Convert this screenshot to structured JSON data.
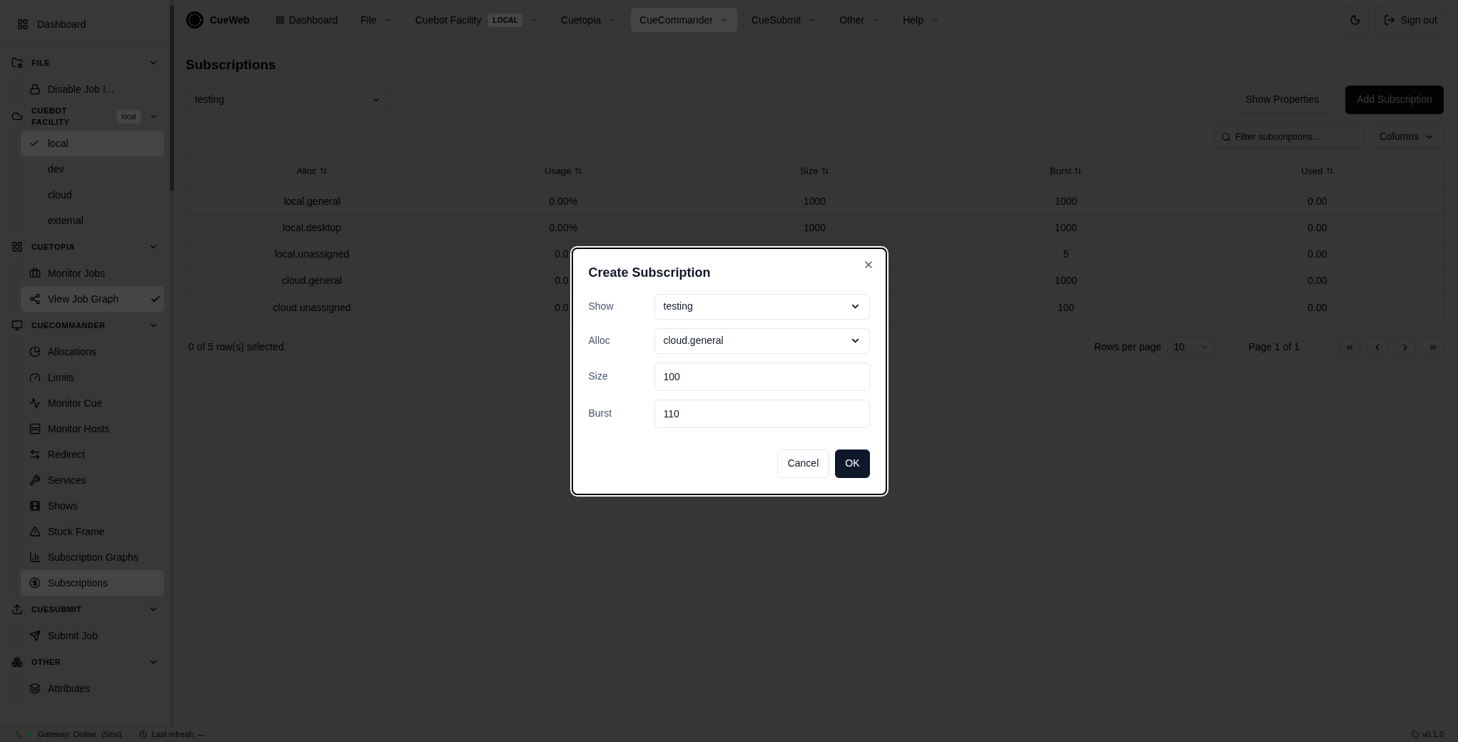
{
  "sidebar": {
    "top_item": {
      "label": "Dashboard"
    },
    "sections": [
      {
        "title": "FILE",
        "expanded": true,
        "items": [
          {
            "label": "Disable Job I...",
            "kind": "link",
            "selected": false,
            "checked": false
          }
        ]
      },
      {
        "title": "CUEBOT FACILITY",
        "badge": "local",
        "expanded": true,
        "items": [
          {
            "label": "local",
            "kind": "option",
            "selected": true,
            "checked": true
          },
          {
            "label": "dev",
            "kind": "option",
            "selected": false,
            "checked": false
          },
          {
            "label": "cloud",
            "kind": "option",
            "selected": false,
            "checked": false
          },
          {
            "label": "external",
            "kind": "option",
            "selected": false,
            "checked": false
          }
        ]
      },
      {
        "title": "CUETOPIA",
        "expanded": true,
        "items": [
          {
            "label": "Monitor Jobs",
            "kind": "link",
            "selected": false,
            "checked": false
          },
          {
            "label": "View Job Graph",
            "kind": "link",
            "selected": true,
            "checked": true
          }
        ]
      },
      {
        "title": "CUECOMMANDER",
        "expanded": true,
        "items": [
          {
            "label": "Allocations",
            "kind": "link",
            "selected": false,
            "checked": false
          },
          {
            "label": "Limits",
            "kind": "link",
            "selected": false,
            "checked": false
          },
          {
            "label": "Monitor Cue",
            "kind": "link",
            "selected": false,
            "checked": false
          },
          {
            "label": "Monitor Hosts",
            "kind": "link",
            "selected": false,
            "checked": false
          },
          {
            "label": "Redirect",
            "kind": "link",
            "selected": false,
            "checked": false
          },
          {
            "label": "Services",
            "kind": "link",
            "selected": false,
            "checked": false
          },
          {
            "label": "Shows",
            "kind": "link",
            "selected": false,
            "checked": false
          },
          {
            "label": "Stuck Frame",
            "kind": "link",
            "selected": false,
            "checked": false
          },
          {
            "label": "Subscription Graphs",
            "kind": "link",
            "selected": false,
            "checked": false
          },
          {
            "label": "Subscriptions",
            "kind": "link",
            "selected": true,
            "checked": false
          }
        ]
      },
      {
        "title": "CUESUBMIT",
        "expanded": true,
        "items": [
          {
            "label": "Submit Job",
            "kind": "link",
            "selected": false,
            "checked": false
          }
        ]
      },
      {
        "title": "OTHER",
        "expanded": true,
        "items": [
          {
            "label": "Attributes",
            "kind": "link",
            "selected": false,
            "checked": false
          }
        ]
      }
    ]
  },
  "header": {
    "brand": "CueWeb",
    "nav": [
      {
        "label": "Dashboard",
        "kind": "link",
        "selected": false
      },
      {
        "label": "File",
        "kind": "menu",
        "selected": false
      },
      {
        "label": "Cuebot Facility",
        "kind": "menu",
        "badge": "LOCAL",
        "selected": false
      },
      {
        "label": "Cuetopia",
        "kind": "menu",
        "selected": false
      },
      {
        "label": "CueCommander",
        "kind": "menu",
        "selected": true
      },
      {
        "label": "CueSubmit",
        "kind": "menu",
        "selected": false
      },
      {
        "label": "Other",
        "kind": "menu",
        "selected": false
      },
      {
        "label": "Help",
        "kind": "menu",
        "selected": false
      }
    ],
    "sign_out": "Sign out"
  },
  "page": {
    "title": "Subscriptions",
    "show_select": "testing",
    "buttons": [
      {
        "label": "Show Properties",
        "kind": "secondary"
      },
      {
        "label": "Add Subscription",
        "kind": "primary"
      }
    ],
    "filter": {
      "placeholder": "Filter subscriptions..."
    },
    "columns_button": "Columns"
  },
  "table": {
    "columns": [
      "Alloc",
      "Usage",
      "Size",
      "Burst",
      "Used"
    ],
    "rows": [
      [
        "local.general",
        "0.00%",
        "1000",
        "1000",
        "0.00"
      ],
      [
        "local.desktop",
        "0.00%",
        "1000",
        "1000",
        "0.00"
      ],
      [
        "local.unassigned",
        "0.0",
        null,
        "5",
        "0.00"
      ],
      [
        "cloud.general",
        "0.0",
        null,
        "1000",
        "0.00"
      ],
      [
        "cloud.unassigned",
        "0.0",
        null,
        "100",
        "0.00"
      ]
    ]
  },
  "footer": {
    "selected": "0 of 5 row(s) selected.",
    "rows_per_page_label": "Rows per page",
    "rows_per_page": "10",
    "page": "Page 1 of 1"
  },
  "dialog": {
    "title": "Create Subscription",
    "fields": [
      {
        "label": "Show",
        "kind": "select",
        "value": "testing"
      },
      {
        "label": "Alloc",
        "kind": "select",
        "value": "cloud.general"
      },
      {
        "label": "Size",
        "kind": "input",
        "value": "100"
      },
      {
        "label": "Burst",
        "kind": "input",
        "value": "110"
      }
    ],
    "buttons": [
      {
        "label": "Cancel",
        "kind": "secondary"
      },
      {
        "label": "OK",
        "kind": "primary"
      }
    ]
  },
  "status_bar": {
    "gateway": "Gateway: Online",
    "online": true,
    "latency": "(5ms)",
    "last_refresh": "Last refresh: —",
    "version": "v0.1.0"
  }
}
